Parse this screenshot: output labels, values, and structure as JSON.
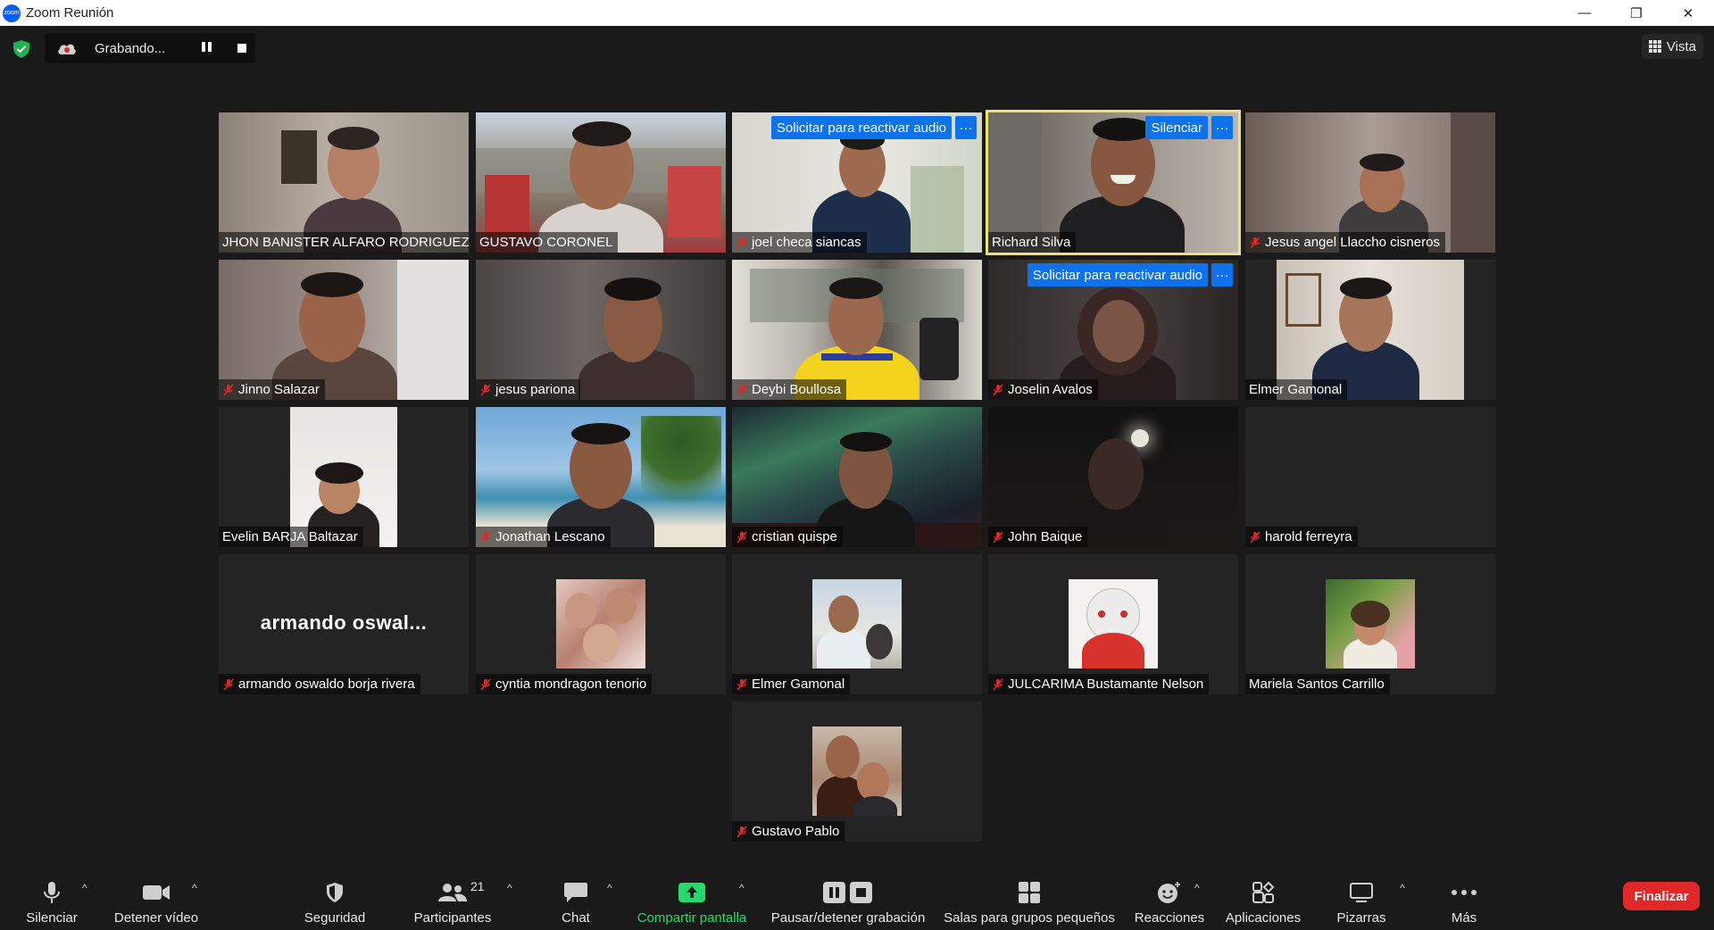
{
  "window": {
    "title": "Zoom Reunión",
    "logo_text": "zoom",
    "minimize": "—",
    "restore": "❐",
    "close": "✕"
  },
  "recording": {
    "status": "Grabando..."
  },
  "view_button": {
    "label": "Vista"
  },
  "participants": [
    {
      "name": "JHON BANISTER ALFARO RODRIGUEZ",
      "muted": false,
      "type": "video"
    },
    {
      "name": "GUSTAVO CORONEL",
      "muted": false,
      "type": "video"
    },
    {
      "name": "joel checa siancas",
      "muted": true,
      "type": "video",
      "action": "Solicitar para reactivar audio"
    },
    {
      "name": "Richard Silva",
      "muted": false,
      "type": "video",
      "action": "Silenciar",
      "speaking": true
    },
    {
      "name": "Jesus angel Llaccho cisneros",
      "muted": true,
      "type": "video"
    },
    {
      "name": "Jinno Salazar",
      "muted": true,
      "type": "video"
    },
    {
      "name": "jesus pariona",
      "muted": true,
      "type": "video"
    },
    {
      "name": "Deybi Boullosa",
      "muted": true,
      "type": "video"
    },
    {
      "name": "Joselin Avalos",
      "muted": true,
      "type": "video",
      "action": "Solicitar para reactivar audio"
    },
    {
      "name": "Elmer Gamonal",
      "muted": false,
      "type": "video"
    },
    {
      "name": "Evelin BARJA  Baltazar",
      "muted": false,
      "type": "video"
    },
    {
      "name": "Jonathan Lescano",
      "muted": true,
      "type": "video"
    },
    {
      "name": "cristian quispe",
      "muted": true,
      "type": "video"
    },
    {
      "name": "John Baique",
      "muted": true,
      "type": "video"
    },
    {
      "name": "harold ferreyra",
      "muted": true,
      "type": "blank"
    },
    {
      "name": "armando oswaldo borja rivera",
      "muted": true,
      "type": "initials",
      "initials": "armando  oswal..."
    },
    {
      "name": "cyntia mondragon tenorio",
      "muted": true,
      "type": "avatar"
    },
    {
      "name": "Elmer Gamonal",
      "muted": true,
      "type": "avatar"
    },
    {
      "name": "JULCARIMA Bustamante Nelson",
      "muted": true,
      "type": "avatar"
    },
    {
      "name": "Mariela Santos Carrillo",
      "muted": false,
      "type": "avatar"
    },
    {
      "name": "Gustavo Pablo",
      "muted": true,
      "type": "avatar"
    }
  ],
  "tile_more": "···",
  "toolbar": {
    "mute": "Silenciar",
    "stop_video": "Detener vídeo",
    "security": "Seguridad",
    "participants": "Participantes",
    "participants_count": "21",
    "chat": "Chat",
    "share_screen": "Compartir pantalla",
    "pause_recording": "Pausar/detener grabación",
    "breakout_rooms": "Salas para grupos pequeños",
    "reactions": "Reacciones",
    "apps": "Aplicaciones",
    "whiteboards": "Pizarras",
    "more": "Más",
    "end": "Finalizar",
    "caret": "^"
  },
  "colors": {
    "speaking_border": "#ece472",
    "action_blue": "#0e72ed",
    "share_green": "#26d96b",
    "end_red": "#e02828",
    "mute_red": "#e02828"
  }
}
